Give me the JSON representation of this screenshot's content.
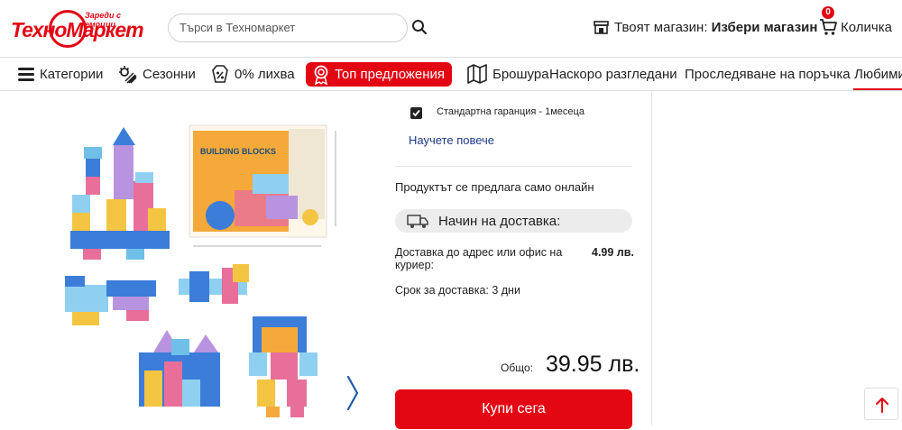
{
  "header": {
    "logo_text": "ТехноМаркет",
    "logo_tagline": "Зареди с емоции",
    "search_placeholder": "Търси в Техномаркет",
    "store_label": "Твоят магазин:",
    "store_value": "Избери магазин",
    "cart_count": "0",
    "cart_label": "Количка"
  },
  "nav": {
    "items": [
      {
        "label": "Категории",
        "icon": "menu-icon"
      },
      {
        "label": "Сезонни",
        "icon": "season-icon"
      },
      {
        "label": "0% лихва",
        "icon": "percent-icon"
      },
      {
        "label": "Топ предложения",
        "icon": "award-icon"
      },
      {
        "label": "Брошура",
        "icon": "brochure-icon"
      },
      {
        "label": "Наскоро разгледани"
      },
      {
        "label": "Проследяване на поръчка"
      },
      {
        "label": "Любими"
      }
    ]
  },
  "product": {
    "box_title": "BUILDING BLOCKS",
    "warranty_label": "Стандартна гаранция - 1месеца",
    "warranty_checked": true,
    "learn_more": "Научете повече",
    "online_only": "Продуктът се предлага само онлайн",
    "delivery_title": "Начин на доставка:",
    "courier_label": "Доставка до адрес или офис на куриер:",
    "courier_price": "4.99 лв.",
    "delivery_term": "Срок за доставка: 3 дни",
    "total_label": "Общо:",
    "total_value": "39.95 лв.",
    "buy_button": "Купи сега"
  },
  "colors": {
    "brand_red": "#e30613",
    "link_blue": "#1e3a8a"
  }
}
